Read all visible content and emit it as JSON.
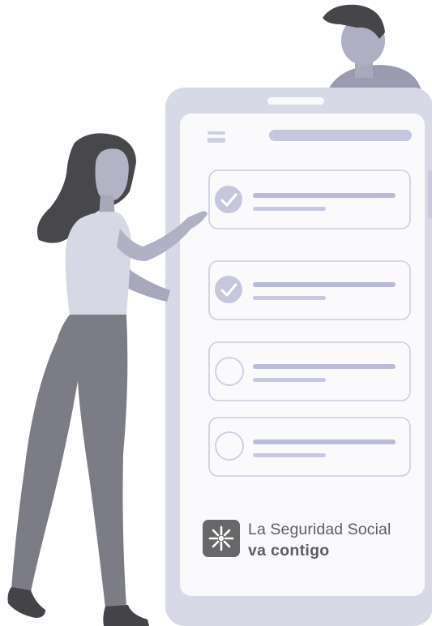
{
  "brand": {
    "line1": "La Seguridad Social",
    "line2": "va contigo",
    "icon": "seguridad-social-logo-icon"
  },
  "checklist": {
    "items": [
      {
        "checked": true
      },
      {
        "checked": true
      },
      {
        "checked": false
      },
      {
        "checked": false
      }
    ]
  },
  "colors": {
    "phone_frame": "#d8d9e6",
    "screen": "#fafafd",
    "accent": "#b6b8d8",
    "figure_dark": "#4e4e52",
    "skin": "#b0b0c4",
    "logo_bg": "#67676a"
  }
}
